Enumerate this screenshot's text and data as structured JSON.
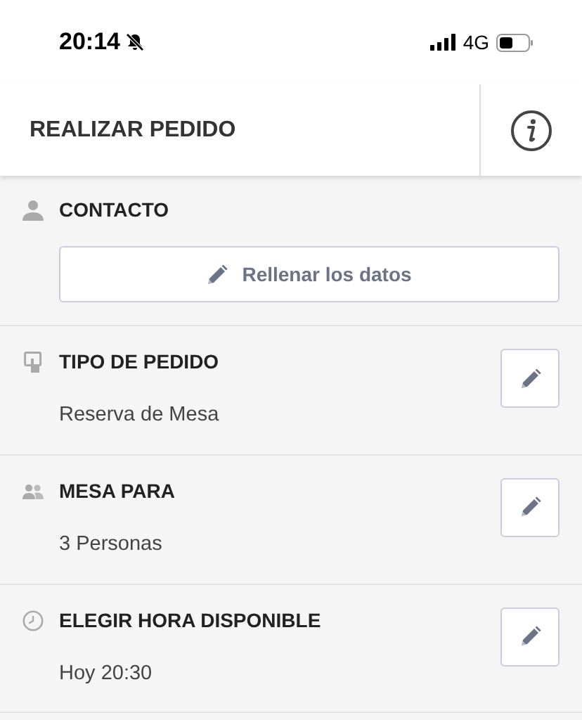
{
  "status_bar": {
    "time": "20:14",
    "network": "4G"
  },
  "header": {
    "title": "REALIZAR PEDIDO"
  },
  "sections": [
    {
      "kind": "action",
      "title": "CONTACTO",
      "button": "Rellenar los datos"
    },
    {
      "kind": "value",
      "title": "TIPO DE PEDIDO",
      "value": "Reserva de Mesa"
    },
    {
      "kind": "value",
      "title": "MESA PARA",
      "value": "3 Personas"
    },
    {
      "kind": "value",
      "title": "ELEGIR HORA DISPONIBLE",
      "value": "Hoy 20:30"
    }
  ]
}
